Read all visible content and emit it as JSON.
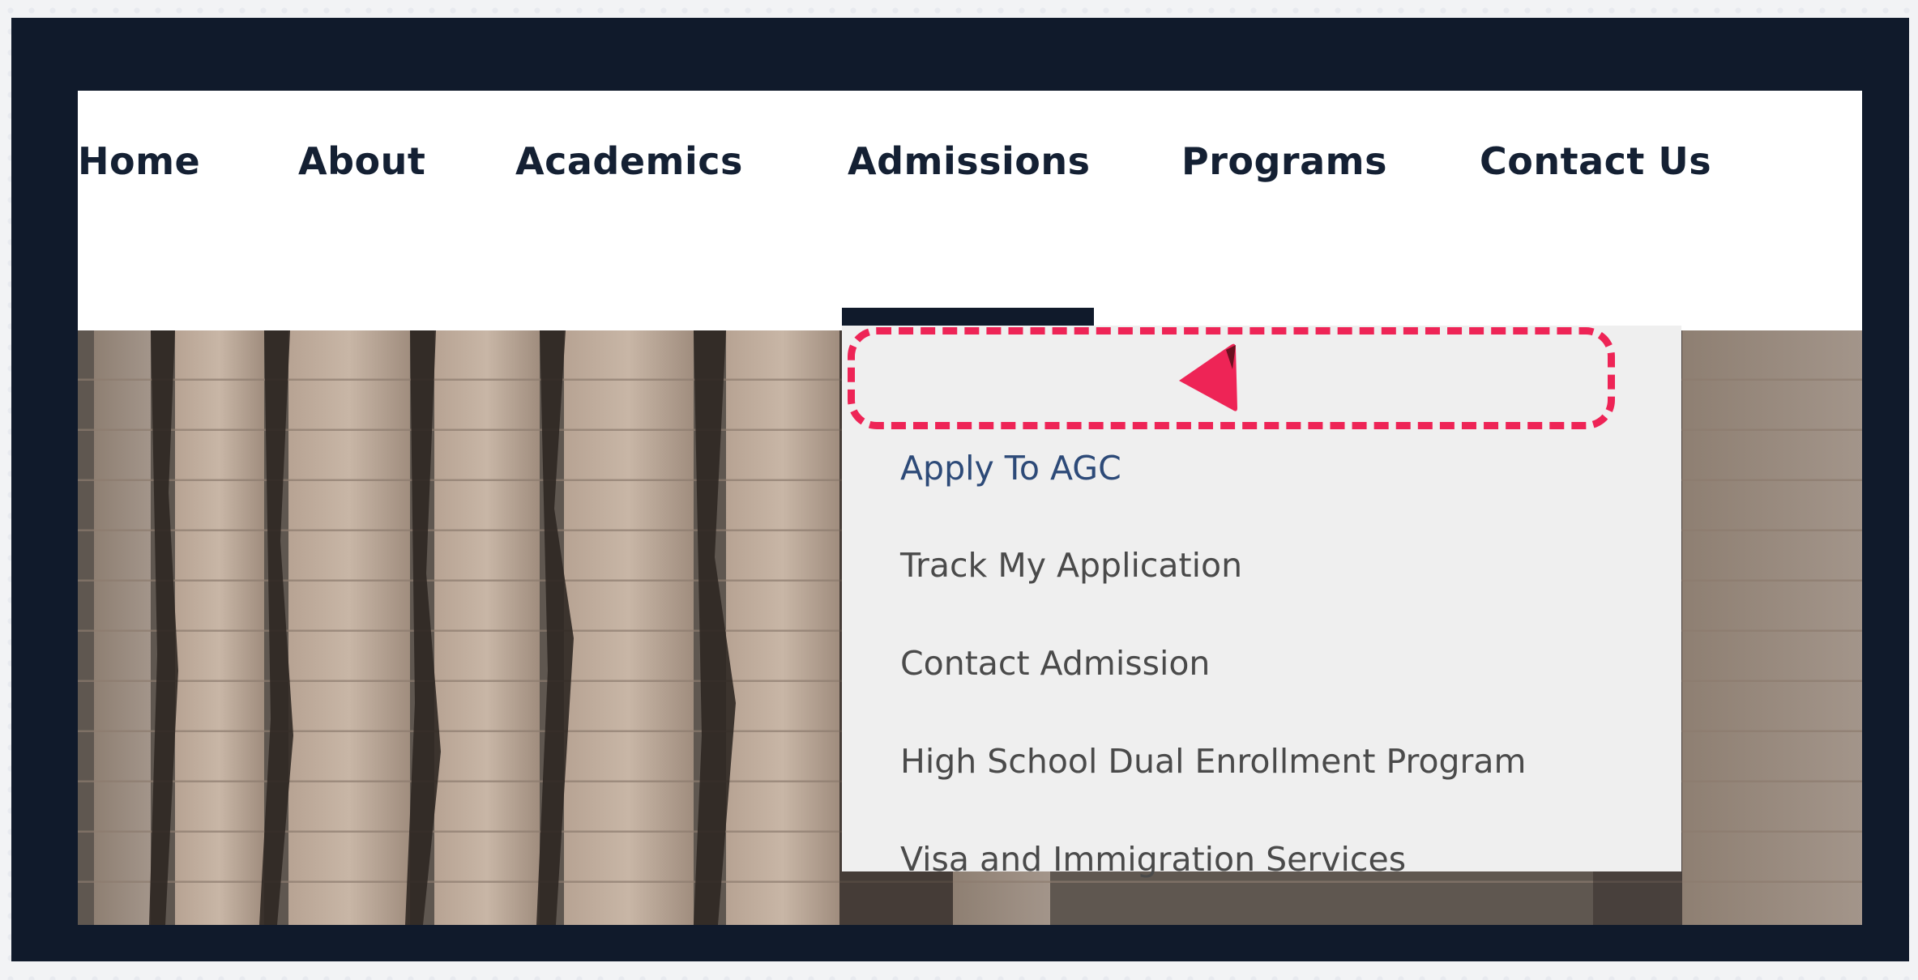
{
  "nav": {
    "items": [
      {
        "label": "Home"
      },
      {
        "label": "About"
      },
      {
        "label": "Academics"
      },
      {
        "label": "Admissions"
      },
      {
        "label": "Programs"
      },
      {
        "label": "Contact Us"
      }
    ],
    "active": "Admissions"
  },
  "dropdown": {
    "items": [
      {
        "label": "Apply To AGC"
      },
      {
        "label": "Track My Application"
      },
      {
        "label": "Contact Admission"
      },
      {
        "label": "High School Dual Enrollment Program"
      },
      {
        "label": "Visa and Immigration Services"
      }
    ],
    "highlighted": "Apply To AGC"
  },
  "colors": {
    "frame": "#101a2b",
    "nav_text": "#142033",
    "dropdown_bg": "#efefef",
    "highlight_text": "#2d4a78",
    "annotation": "#ee2456"
  },
  "icons": {
    "pointer": "pointer-arrow-icon"
  }
}
